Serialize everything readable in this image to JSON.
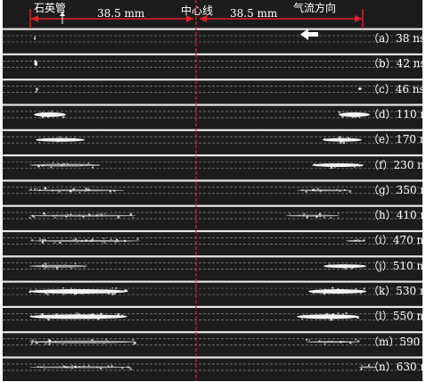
{
  "header": {
    "quartz_tube": "石英管",
    "center_line": "中心线",
    "flow_direction": "气流方向",
    "distance_left": "38.5 mm",
    "distance_right": "38.5 mm"
  },
  "colors": {
    "background": "#1c1c1c",
    "separator": "#e6e6e6",
    "center_line": "#e0202a",
    "arrow_red": "#e0202a",
    "dashed_guides": "#9a9a9a",
    "discharge": "#ffffff"
  },
  "icons": {
    "flow_arrow": "arrow-left-icon",
    "quartz_pointer": "arrow-up-icon"
  },
  "frames": [
    {
      "label": "（a）38 ns"
    },
    {
      "label": "（b）42 ns"
    },
    {
      "label": "（c）46 ns"
    },
    {
      "label": "（d）110 ns"
    },
    {
      "label": "（e）170 ns"
    },
    {
      "label": "（f）230 ns"
    },
    {
      "label": "（g）350 ns"
    },
    {
      "label": "（h）410 ns"
    },
    {
      "label": "（i）470 ns"
    },
    {
      "label": "（j）510 ns"
    },
    {
      "label": "（k）530 ns"
    },
    {
      "label": "（l）550 ns"
    },
    {
      "label": "（m）590 ns"
    },
    {
      "label": "（n）630 ns"
    }
  ]
}
